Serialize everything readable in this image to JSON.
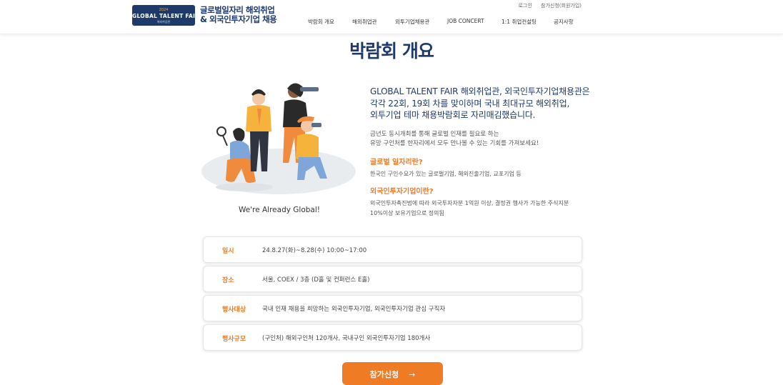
{
  "header": {
    "badge": {
      "year": "2024",
      "title": "GLOBAL TALENT FAIR",
      "sub": "해외취업관"
    },
    "logo_line1": "글로벌일자리 해외취업",
    "logo_line2": "& 외국인투자기업 채용",
    "util_links": [
      "로그인",
      "참가신청(회원가입)"
    ],
    "nav": [
      "박람회 개요",
      "해외취업관",
      "외투기업채용관",
      "JOB CONCERT",
      "1:1 취업컨설팅",
      "공지사항"
    ]
  },
  "main": {
    "title": "박람회 개요",
    "caption": "We're Already Global!",
    "intro_head": [
      "GLOBAL TALENT FAIR 해외취업관, 외국인투자기업채용관은",
      "각각 22회, 19회 차를 맞이하며 국내 최대규모 해외취업,",
      "외투기업 테마 채용박람회로 자리매김했습니다."
    ],
    "intro_desc": [
      "금년도 동시개최를 통해 글로벌 인재를 필요로 하는",
      "유망 구인처를 한자리에서 모두 만나볼 수 있는 기회를 가져보세요!"
    ],
    "q1": "글로벌 일자리란?",
    "a1": [
      "한국인 구인수요가 있는 글로벌기업, 해외진출기업, 교포기업 등"
    ],
    "q2": "외국인투자기업이란?",
    "a2": [
      "외국인투자촉진법에 따라 외국투자자분 1억원 이상, 결정권 행사가 가능한 주식지분",
      "10%이상 보유기업으로 정의됨"
    ]
  },
  "info": [
    {
      "label": "일시",
      "value": "24.8.27(화)~8.28(수) 10:00~17:00"
    },
    {
      "label": "장소",
      "value": "서울, COEX / 3층 (D홀 및 컨퍼런스 E홀)"
    },
    {
      "label": "행사대상",
      "value": "국내 인재 채용을 희망하는 외국인투자기업, 외국인투자기업 관심 구직자"
    },
    {
      "label": "행사규모",
      "value": "(구인처) 해외구인처 120개사, 국내구인 외국인투자기업 180개사"
    }
  ],
  "apply": {
    "label": "참가신청",
    "arrow": "→"
  },
  "colors": {
    "navy": "#1d3a6b",
    "accent": "#f07b25"
  }
}
